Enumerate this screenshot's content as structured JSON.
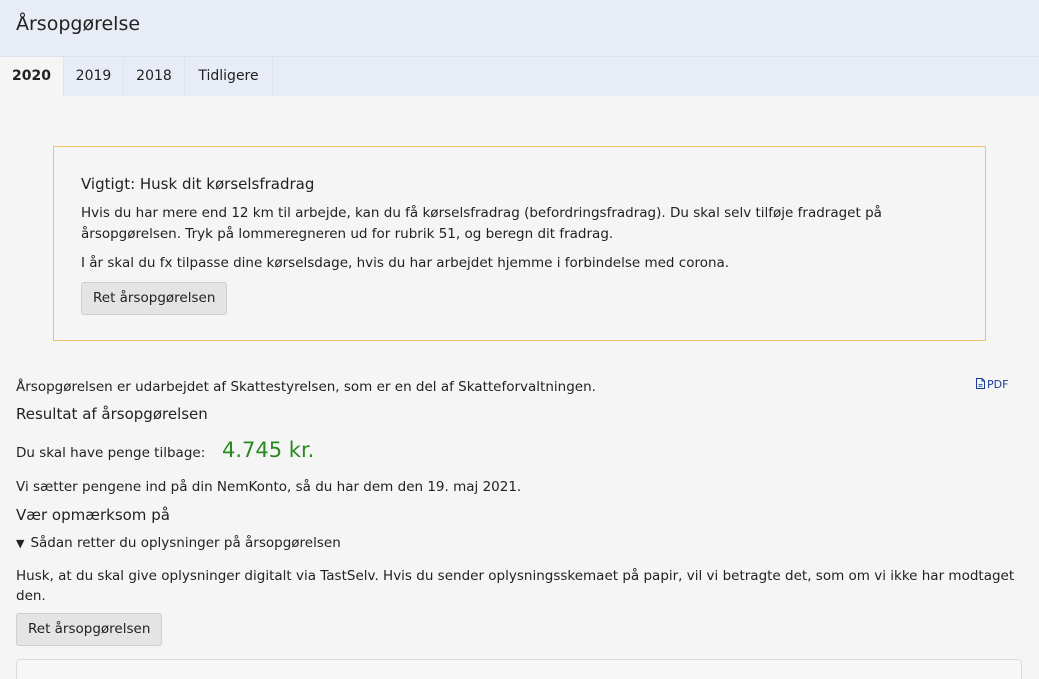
{
  "header": {
    "title": "Årsopgørelse"
  },
  "tabs": [
    {
      "label": "2020",
      "active": true
    },
    {
      "label": "2019",
      "active": false
    },
    {
      "label": "2018",
      "active": false
    },
    {
      "label": "Tidligere",
      "active": false
    }
  ],
  "notice": {
    "title": "Vigtigt: Husk dit kørselsfradrag",
    "paragraph1": "Hvis du har mere end 12 km til arbejde, kan du få kørselsfradrag (befordringsfradrag). Du skal selv tilføje fradraget på årsopgørelsen. Tryk på lommeregneren ud for rubrik 51, og beregn dit fradrag.",
    "paragraph2": "I år skal du fx tilpasse dine kørselsdage, hvis du har arbejdet hjemme i forbindelse med corona.",
    "button_label": "Ret årsopgørelsen",
    "border_color": "#f0c36a"
  },
  "info": {
    "prepared_by": "Årsopgørelsen er udarbejdet af Skattestyrelsen, som er en del af Skatteforvaltningen.",
    "pdf_label": "PDF",
    "pdf_icon": "document-icon"
  },
  "result": {
    "heading": "Resultat af årsopgørelsen",
    "refund_label": "Du skal have penge tilbage:",
    "refund_amount": "4.745 kr.",
    "amount_color": "#2a8a1f",
    "payout_text": "Vi sætter pengene ind på din NemKonto, så du har dem den 19. maj 2021."
  },
  "attention": {
    "heading": "Vær opmærksom på",
    "disclosure_arrow": "▼",
    "disclosure_label": "Sådan retter du oplysninger på årsopgørelsen",
    "body": "Husk, at du skal give oplysninger digitalt via TastSelv. Hvis du sender oplysningsskemaet på papir, vil vi betragte det, som om vi ikke har modtaget den.",
    "button_label": "Ret årsopgørelsen"
  }
}
